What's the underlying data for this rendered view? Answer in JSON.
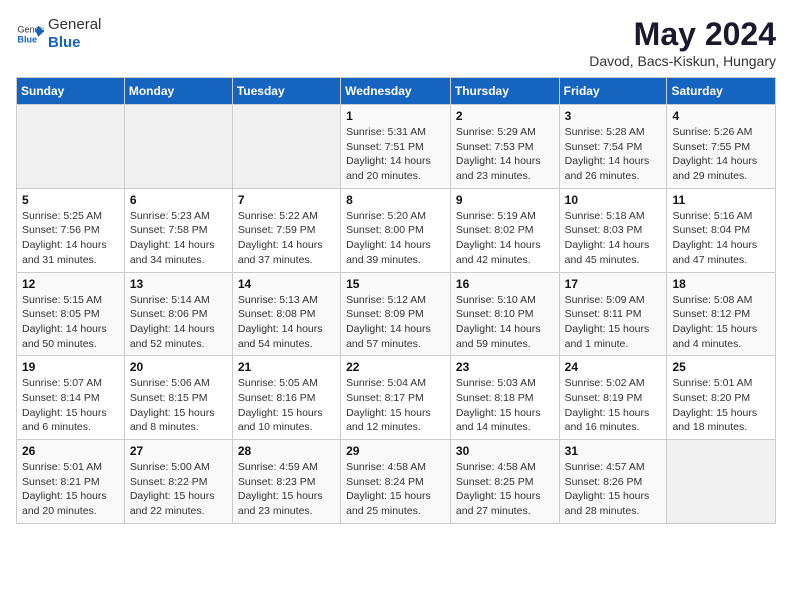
{
  "header": {
    "logo_general": "General",
    "logo_blue": "Blue",
    "title": "May 2024",
    "subtitle": "Davod, Bacs-Kiskun, Hungary"
  },
  "weekdays": [
    "Sunday",
    "Monday",
    "Tuesday",
    "Wednesday",
    "Thursday",
    "Friday",
    "Saturday"
  ],
  "weeks": [
    [
      {
        "day": "",
        "info": ""
      },
      {
        "day": "",
        "info": ""
      },
      {
        "day": "",
        "info": ""
      },
      {
        "day": "1",
        "info": "Sunrise: 5:31 AM\nSunset: 7:51 PM\nDaylight: 14 hours\nand 20 minutes."
      },
      {
        "day": "2",
        "info": "Sunrise: 5:29 AM\nSunset: 7:53 PM\nDaylight: 14 hours\nand 23 minutes."
      },
      {
        "day": "3",
        "info": "Sunrise: 5:28 AM\nSunset: 7:54 PM\nDaylight: 14 hours\nand 26 minutes."
      },
      {
        "day": "4",
        "info": "Sunrise: 5:26 AM\nSunset: 7:55 PM\nDaylight: 14 hours\nand 29 minutes."
      }
    ],
    [
      {
        "day": "5",
        "info": "Sunrise: 5:25 AM\nSunset: 7:56 PM\nDaylight: 14 hours\nand 31 minutes."
      },
      {
        "day": "6",
        "info": "Sunrise: 5:23 AM\nSunset: 7:58 PM\nDaylight: 14 hours\nand 34 minutes."
      },
      {
        "day": "7",
        "info": "Sunrise: 5:22 AM\nSunset: 7:59 PM\nDaylight: 14 hours\nand 37 minutes."
      },
      {
        "day": "8",
        "info": "Sunrise: 5:20 AM\nSunset: 8:00 PM\nDaylight: 14 hours\nand 39 minutes."
      },
      {
        "day": "9",
        "info": "Sunrise: 5:19 AM\nSunset: 8:02 PM\nDaylight: 14 hours\nand 42 minutes."
      },
      {
        "day": "10",
        "info": "Sunrise: 5:18 AM\nSunset: 8:03 PM\nDaylight: 14 hours\nand 45 minutes."
      },
      {
        "day": "11",
        "info": "Sunrise: 5:16 AM\nSunset: 8:04 PM\nDaylight: 14 hours\nand 47 minutes."
      }
    ],
    [
      {
        "day": "12",
        "info": "Sunrise: 5:15 AM\nSunset: 8:05 PM\nDaylight: 14 hours\nand 50 minutes."
      },
      {
        "day": "13",
        "info": "Sunrise: 5:14 AM\nSunset: 8:06 PM\nDaylight: 14 hours\nand 52 minutes."
      },
      {
        "day": "14",
        "info": "Sunrise: 5:13 AM\nSunset: 8:08 PM\nDaylight: 14 hours\nand 54 minutes."
      },
      {
        "day": "15",
        "info": "Sunrise: 5:12 AM\nSunset: 8:09 PM\nDaylight: 14 hours\nand 57 minutes."
      },
      {
        "day": "16",
        "info": "Sunrise: 5:10 AM\nSunset: 8:10 PM\nDaylight: 14 hours\nand 59 minutes."
      },
      {
        "day": "17",
        "info": "Sunrise: 5:09 AM\nSunset: 8:11 PM\nDaylight: 15 hours\nand 1 minute."
      },
      {
        "day": "18",
        "info": "Sunrise: 5:08 AM\nSunset: 8:12 PM\nDaylight: 15 hours\nand 4 minutes."
      }
    ],
    [
      {
        "day": "19",
        "info": "Sunrise: 5:07 AM\nSunset: 8:14 PM\nDaylight: 15 hours\nand 6 minutes."
      },
      {
        "day": "20",
        "info": "Sunrise: 5:06 AM\nSunset: 8:15 PM\nDaylight: 15 hours\nand 8 minutes."
      },
      {
        "day": "21",
        "info": "Sunrise: 5:05 AM\nSunset: 8:16 PM\nDaylight: 15 hours\nand 10 minutes."
      },
      {
        "day": "22",
        "info": "Sunrise: 5:04 AM\nSunset: 8:17 PM\nDaylight: 15 hours\nand 12 minutes."
      },
      {
        "day": "23",
        "info": "Sunrise: 5:03 AM\nSunset: 8:18 PM\nDaylight: 15 hours\nand 14 minutes."
      },
      {
        "day": "24",
        "info": "Sunrise: 5:02 AM\nSunset: 8:19 PM\nDaylight: 15 hours\nand 16 minutes."
      },
      {
        "day": "25",
        "info": "Sunrise: 5:01 AM\nSunset: 8:20 PM\nDaylight: 15 hours\nand 18 minutes."
      }
    ],
    [
      {
        "day": "26",
        "info": "Sunrise: 5:01 AM\nSunset: 8:21 PM\nDaylight: 15 hours\nand 20 minutes."
      },
      {
        "day": "27",
        "info": "Sunrise: 5:00 AM\nSunset: 8:22 PM\nDaylight: 15 hours\nand 22 minutes."
      },
      {
        "day": "28",
        "info": "Sunrise: 4:59 AM\nSunset: 8:23 PM\nDaylight: 15 hours\nand 23 minutes."
      },
      {
        "day": "29",
        "info": "Sunrise: 4:58 AM\nSunset: 8:24 PM\nDaylight: 15 hours\nand 25 minutes."
      },
      {
        "day": "30",
        "info": "Sunrise: 4:58 AM\nSunset: 8:25 PM\nDaylight: 15 hours\nand 27 minutes."
      },
      {
        "day": "31",
        "info": "Sunrise: 4:57 AM\nSunset: 8:26 PM\nDaylight: 15 hours\nand 28 minutes."
      },
      {
        "day": "",
        "info": ""
      }
    ]
  ]
}
